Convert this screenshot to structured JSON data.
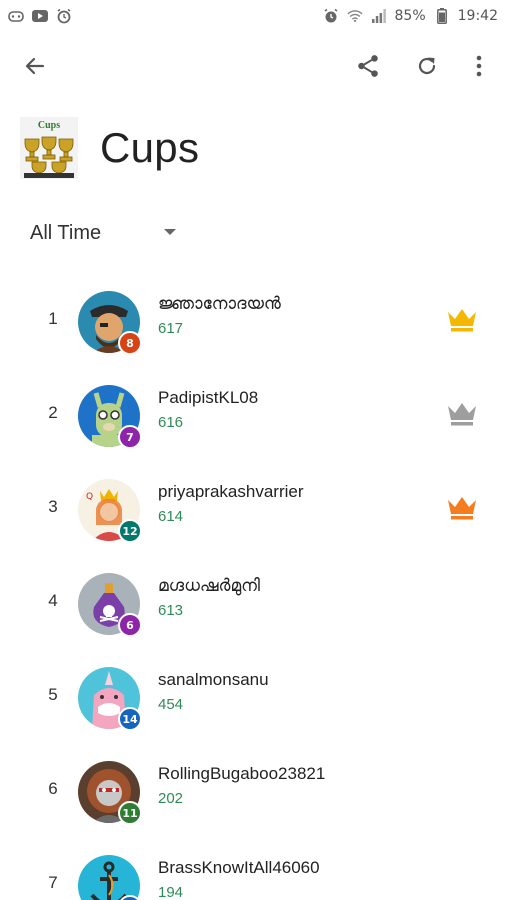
{
  "status_bar": {
    "battery_percent": "85%",
    "time": "19:42",
    "left_icons": [
      "game-controller-icon",
      "youtube-icon",
      "alarm-icon"
    ],
    "right_icons": [
      "alarm-icon",
      "wifi-icon",
      "signal-icon",
      "battery-icon"
    ]
  },
  "toolbar": {
    "back_icon": "arrow-back-icon",
    "share_icon": "share-icon",
    "refresh_icon": "refresh-icon",
    "more_icon": "more-vertical-icon"
  },
  "header": {
    "image_caption": "Cups",
    "title": "Cups"
  },
  "filter": {
    "selected": "All Time"
  },
  "colors": {
    "score_green": "#2e8b57",
    "crown_gold": "#f5b800",
    "crown_silver": "#9e9e9e",
    "crown_bronze": "#f57c1f"
  },
  "leaderboard": [
    {
      "rank": "1",
      "name": "ജ്ഞാനോദയൻ",
      "score": "617",
      "level": "8",
      "badge_color": "#d84315",
      "crown": "gold"
    },
    {
      "rank": "2",
      "name": "PadipistKL08",
      "score": "616",
      "level": "7",
      "badge_color": "#8e24aa",
      "crown": "silver"
    },
    {
      "rank": "3",
      "name": "priyaprakashvarrier",
      "score": "614",
      "level": "12",
      "badge_color": "#00796b",
      "crown": "bronze"
    },
    {
      "rank": "4",
      "name": "മഗ്ദധഷർമുനി",
      "score": "613",
      "level": "6",
      "badge_color": "#8e24aa",
      "crown": ""
    },
    {
      "rank": "5",
      "name": "sanalmonsanu",
      "score": "454",
      "level": "14",
      "badge_color": "#1565c0",
      "crown": ""
    },
    {
      "rank": "6",
      "name": "RollingBugaboo23821",
      "score": "202",
      "level": "11",
      "badge_color": "#2e7d32",
      "crown": ""
    },
    {
      "rank": "7",
      "name": "BrassKnowItAll46060",
      "score": "194",
      "level": "",
      "badge_color": "#1565c0",
      "crown": ""
    }
  ]
}
